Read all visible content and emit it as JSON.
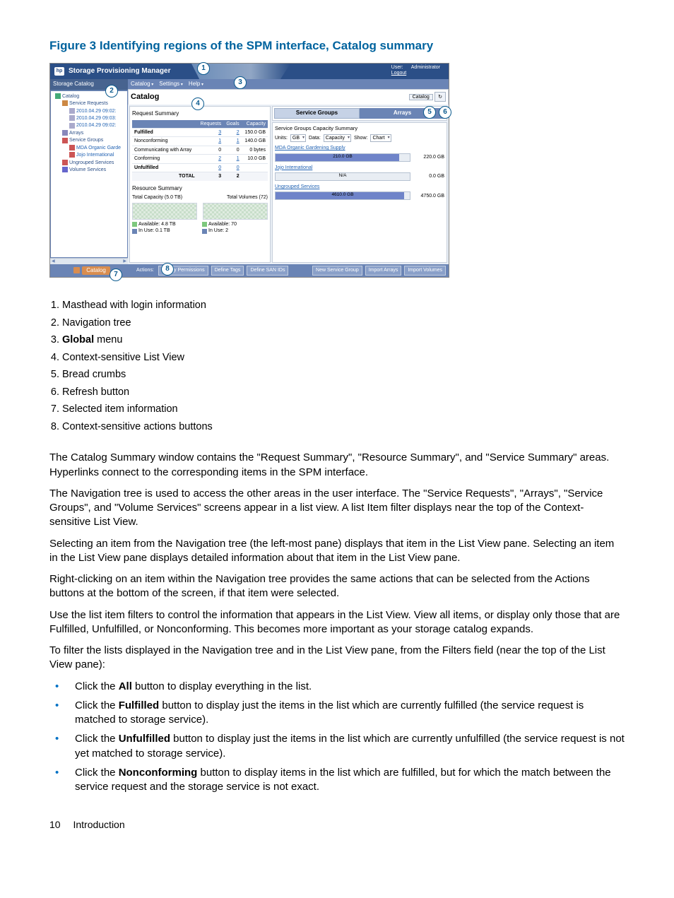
{
  "figure_title": "Figure 3 Identifying regions of the SPM interface, Catalog summary",
  "spm": {
    "app_title": "Storage Provisioning Manager",
    "user_label": "User:",
    "user_value": "Administrator",
    "logout": "Logout",
    "sidebar_title": "Storage Catalog",
    "tree": {
      "catalog": "Catalog",
      "service_requests": "Service Requests",
      "req1": "2010.04.29 09:02:",
      "req2": "2010.04.29 09:03:",
      "req3": "2010.04.29 09:02:",
      "arrays": "Arrays",
      "service_groups": "Service Groups",
      "sg1": "MDA Organic Garde",
      "sg2": "Jojo International",
      "ungrouped": "Ungrouped Services",
      "volume_services": "Volume Services"
    },
    "menu": {
      "catalog": "Catalog",
      "settings": "Settings",
      "help": "Help"
    },
    "catalog_heading": "Catalog",
    "catalog_crumb": "Catalog",
    "request_summary_title": "Request Summary",
    "req_table": {
      "h1": "",
      "h2": "Requests",
      "h3": "Goals",
      "h4": "Capacity",
      "r1": {
        "label": "Fulfilled",
        "req": "3",
        "goals": "2",
        "cap": "150.0 GB"
      },
      "r2": {
        "label": "Nonconforming",
        "req": "1",
        "goals": "1",
        "cap": "140.0 GB"
      },
      "r3": {
        "label": "Communicating with Array",
        "req": "0",
        "goals": "0",
        "cap": "0 bytes"
      },
      "r4": {
        "label": "Conforming",
        "req": "2",
        "goals": "1",
        "cap": "10.0 GB"
      },
      "r5": {
        "label": "Unfulfilled",
        "req": "0",
        "goals": "0",
        "cap": ""
      },
      "total": {
        "label": "TOTAL",
        "req": "3",
        "goals": "2",
        "cap": ""
      }
    },
    "resource_summary_title": "Resource Summary",
    "total_capacity": "Total Capacity (5.0 TB)",
    "total_volumes": "Total Volumes (72)",
    "avail_cap": "Available: 4.8 TB",
    "inuse_cap": "In Use: 0.1 TB",
    "avail_vol": "Available: 70",
    "inuse_vol": "In Use: 2",
    "svc_sum": {
      "groups_btn": "Service Groups",
      "arrays_btn": "Arrays",
      "title": "Service Groups Capacity Summary",
      "units_lbl": "Units:",
      "units_val": "GB",
      "data_lbl": "Data:",
      "data_val": "Capacity",
      "show_lbl": "Show:",
      "show_val": "Chart",
      "g1": {
        "name": "MDA Organic Gardening Supply",
        "used": "210.0 GB",
        "cap": "220.0 GB",
        "pct": 92
      },
      "g2": {
        "name": "Jojo International",
        "used": "N/A",
        "cap": "0.0 GB",
        "pct": 0
      },
      "g3": {
        "name": "Ungrouped Services",
        "used": "4610.0 GB",
        "cap": "4750.0 GB",
        "pct": 96
      }
    },
    "sel_item": "Catalog",
    "actions": {
      "label": "Actions:",
      "modify": "Modify Permissions",
      "tags": "Define Tags",
      "san": "Define SAN IDs",
      "newsg": "New Service Group",
      "imparr": "Import Arrays",
      "impvol": "Import Volumes"
    }
  },
  "callouts": {
    "c1": "Masthead with login information",
    "c2": "Navigation tree",
    "c3_pre": "Global",
    "c3_post": " menu",
    "c4": "Context-sensitive List View",
    "c5": "Bread crumbs",
    "c6": "Refresh button",
    "c7": "Selected item information",
    "c8": "Context-sensitive actions buttons"
  },
  "paras": {
    "p1": "The Catalog Summary window contains the \"Request Summary\", \"Resource Summary\", and \"Service Summary\" areas. Hyperlinks connect to the corresponding items in the SPM interface.",
    "p2": "The Navigation tree is used to access the other areas in the user interface. The \"Service Requests\", \"Arrays\", \"Service Groups\", and \"Volume Services\" screens appear in a list view. A list Item filter displays near the top of the Context-sensitive List View.",
    "p3": "Selecting an item from the Navigation tree (the left-most pane) displays that item in the List View pane. Selecting an item in the List View pane displays detailed information about that item in the List View pane.",
    "p4": "Right-clicking on an item within the Navigation tree provides the same actions that can be selected from the Actions buttons at the bottom of the screen, if that item were selected.",
    "p5": "Use the list item filters to control the information that appears in the List View. View all items, or display only those that are Fulfilled, Unfulfilled, or Nonconforming. This becomes more important as your storage catalog expands.",
    "p6": "To filter the lists displayed in the Navigation tree and in the List View pane, from the Filters field (near the top of the List View pane):"
  },
  "bullets": {
    "b1_pre": "Click the ",
    "b1_b": "All",
    "b1_post": " button to display everything in the list.",
    "b2_pre": "Click the ",
    "b2_b": "Fulfilled",
    "b2_post": " button to display just the items in the list which are currently fulfilled (the service request is matched to storage service).",
    "b3_pre": "Click the ",
    "b3_b": "Unfulfilled",
    "b3_post": " button to display just the items in the list which are currently unfulfilled (the service request is not yet matched to storage service).",
    "b4_pre": "Click the ",
    "b4_b": "Nonconforming",
    "b4_post": " button to display items in the list which are fulfilled, but for which the match between the service request and the storage service is not exact."
  },
  "footer": {
    "page": "10",
    "section": "Introduction"
  }
}
